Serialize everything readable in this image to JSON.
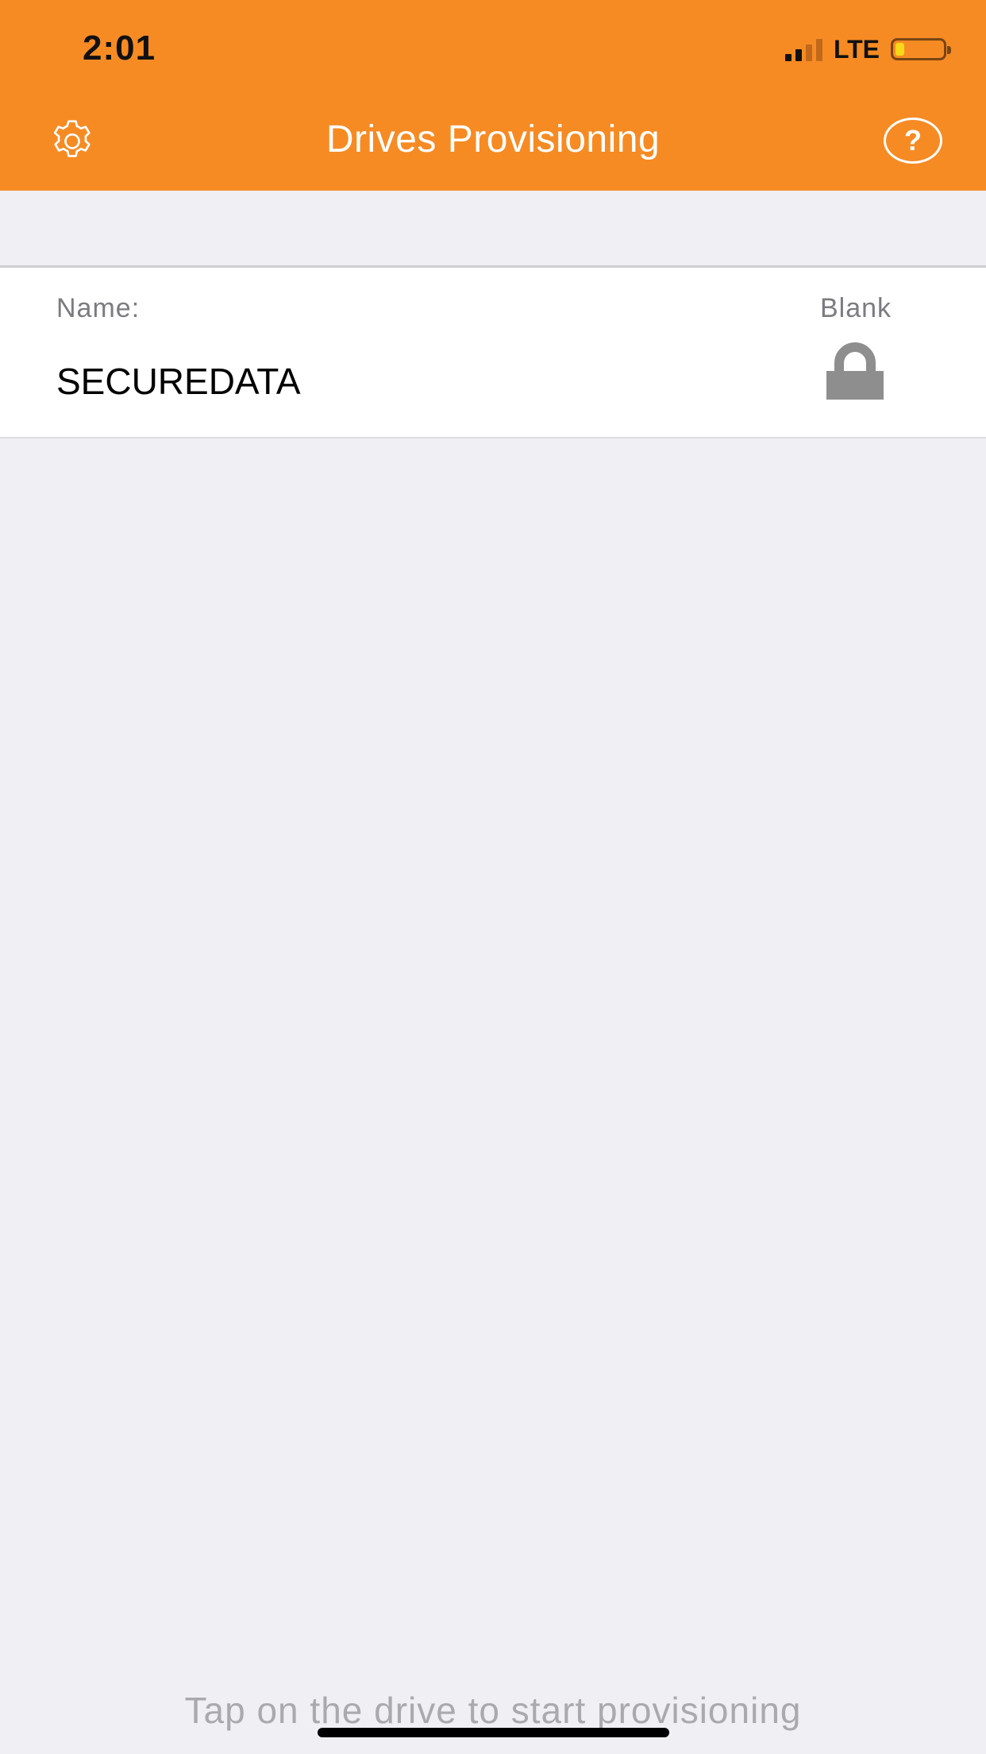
{
  "status_bar": {
    "time": "2:01",
    "network": "LTE",
    "icons": [
      "signal-bars-icon",
      "battery-icon"
    ]
  },
  "nav": {
    "title": "Drives Provisioning",
    "left_icon": "gear-icon",
    "right_icon": "help-icon",
    "help_glyph": "?"
  },
  "drives": [
    {
      "name_label": "Name:",
      "name": "SECUREDATA",
      "status": "Blank",
      "status_icon": "lock-icon"
    }
  ],
  "footer": {
    "hint": "Tap on the drive to start provisioning"
  },
  "colors": {
    "header_bg": "#f68b24",
    "page_bg": "#efeff4",
    "row_bg": "#ffffff",
    "label_text": "#7b7b80",
    "hint_text": "#a9a9ae",
    "lock": "#8e8e8e",
    "battery_level": "#f7d917"
  }
}
